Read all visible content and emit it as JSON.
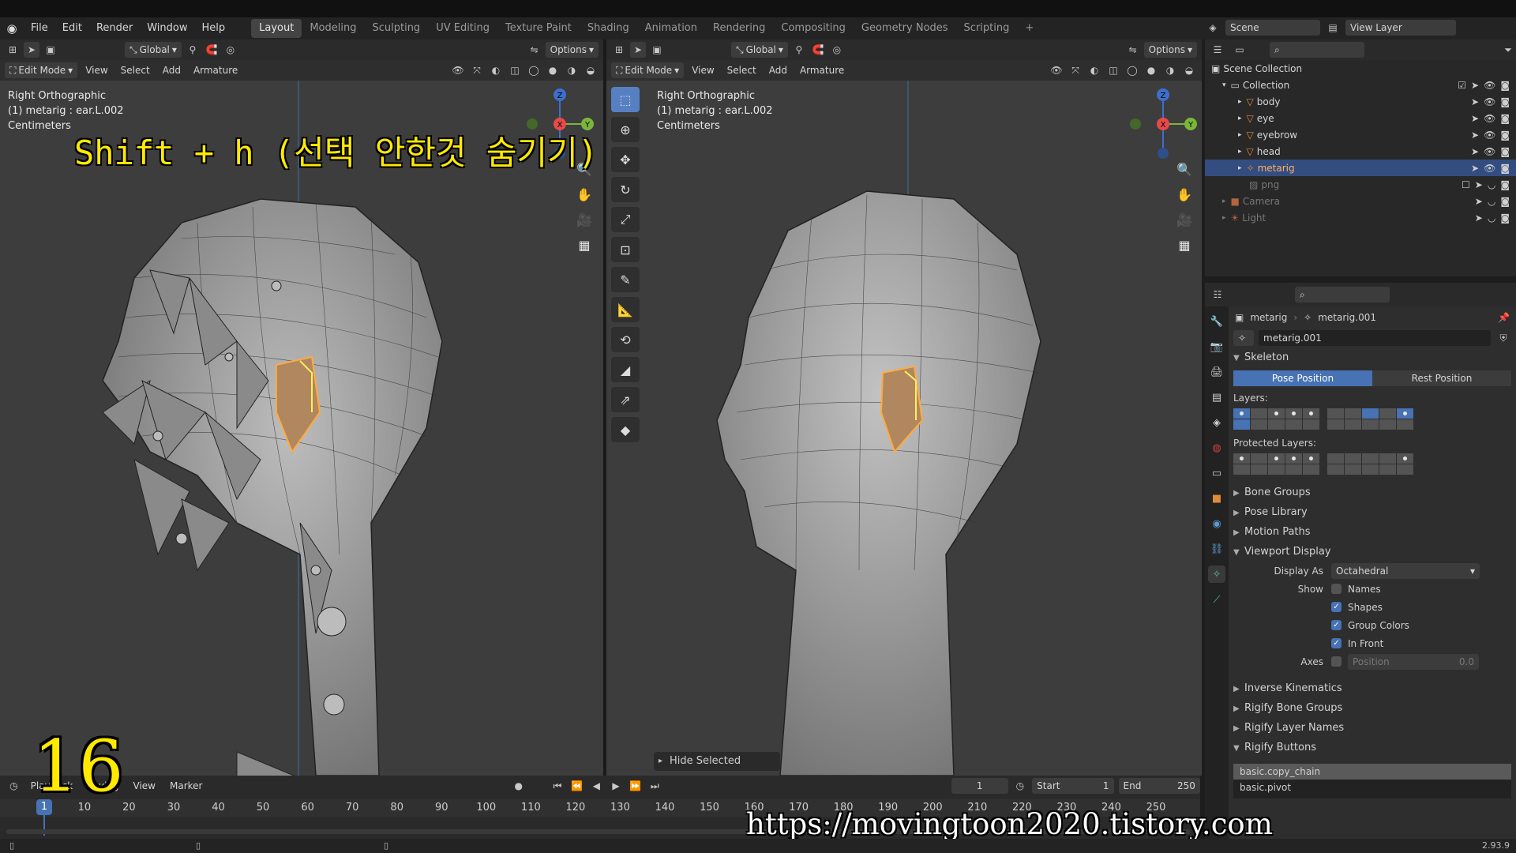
{
  "app": {
    "menu": [
      "File",
      "Edit",
      "Render",
      "Window",
      "Help"
    ],
    "version": "2.93.9"
  },
  "workspaces": [
    "Layout",
    "Modeling",
    "Sculpting",
    "UV Editing",
    "Texture Paint",
    "Shading",
    "Animation",
    "Rendering",
    "Compositing",
    "Geometry Nodes",
    "Scripting"
  ],
  "workspace_active": "Layout",
  "scene": {
    "scene_name": "Scene",
    "view_layer": "View Layer"
  },
  "viewport_left": {
    "mode": "Edit Mode",
    "menus": [
      "View",
      "Select",
      "Add",
      "Armature"
    ],
    "orientation": "Global",
    "options_label": "Options",
    "info": [
      "Right Orthographic",
      "(1) metarig : ear.L.002",
      "Centimeters"
    ]
  },
  "viewport_right": {
    "mode": "Edit Mode",
    "menus": [
      "View",
      "Select",
      "Add",
      "Armature"
    ],
    "orientation": "Global",
    "options_label": "Options",
    "info": [
      "Right Orthographic",
      "(1) metarig : ear.L.002",
      "Centimeters"
    ],
    "popup": "Hide Selected"
  },
  "overlay": {
    "caption": "Shift + h (선택 안한것 숨기기)",
    "number": "16",
    "url": "https://movingtoon2020.tistory.com"
  },
  "gizmo": {
    "z": "Z",
    "x": "X",
    "y": "Y"
  },
  "outliner": {
    "root": "Scene Collection",
    "collection": "Collection",
    "items": [
      {
        "name": "body",
        "selected": false
      },
      {
        "name": "eye",
        "selected": false
      },
      {
        "name": "eyebrow",
        "selected": false
      },
      {
        "name": "head",
        "selected": false
      },
      {
        "name": "metarig",
        "selected": true
      },
      {
        "name": "png",
        "selected": false
      },
      {
        "name": "Camera",
        "selected": false
      },
      {
        "name": "Light",
        "selected": false
      }
    ]
  },
  "properties": {
    "breadcrumb": [
      "metarig",
      "metarig.001"
    ],
    "datablock": "metarig.001",
    "skeleton": "Skeleton",
    "pose_position": "Pose Position",
    "rest_position": "Rest Position",
    "layers_label": "Layers:",
    "protected_layers_label": "Protected Layers:",
    "sections_collapsed_top": [
      "Bone Groups",
      "Pose Library",
      "Motion Paths"
    ],
    "viewport_display": "Viewport Display",
    "display_as_label": "Display As",
    "display_as_value": "Octahedral",
    "show_label": "Show",
    "show": [
      {
        "label": "Names",
        "checked": false
      },
      {
        "label": "Shapes",
        "checked": true
      },
      {
        "label": "Group Colors",
        "checked": true
      },
      {
        "label": "In Front",
        "checked": true
      }
    ],
    "axes_label": "Axes",
    "axes_position": "Position",
    "axes_value": "0.0",
    "sections_collapsed_bottom": [
      "Inverse Kinematics",
      "Rigify Bone Groups",
      "Rigify Layer Names"
    ],
    "rigify_buttons": "Rigify Buttons",
    "rigify_items": [
      "basic.copy_chain",
      "basic.pivot"
    ]
  },
  "timeline": {
    "menus": [
      "Playback",
      "Keying",
      "View",
      "Marker"
    ],
    "current_frame": "1",
    "start_label": "Start",
    "start": "1",
    "end_label": "End",
    "end": "250",
    "ticks": [
      "1",
      "10",
      "20",
      "30",
      "40",
      "50",
      "60",
      "70",
      "80",
      "90",
      "100",
      "110",
      "120",
      "130",
      "140",
      "150",
      "160",
      "170",
      "180",
      "190",
      "200",
      "210",
      "220",
      "230",
      "240",
      "250"
    ]
  }
}
